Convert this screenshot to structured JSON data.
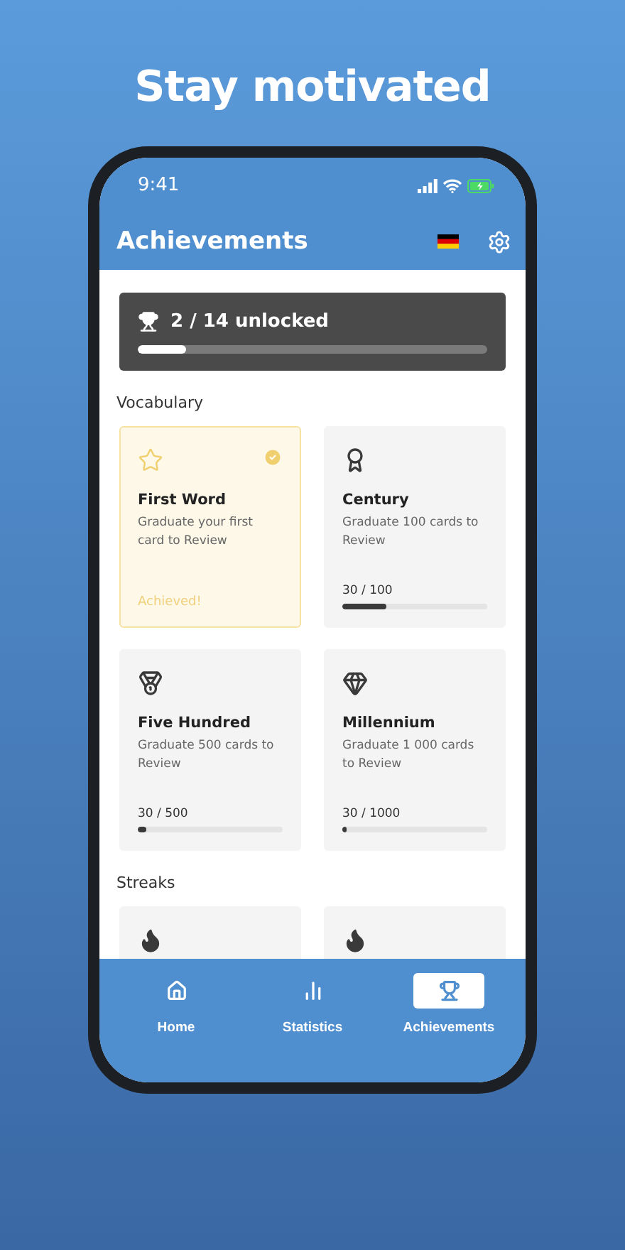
{
  "headline": "Stay motivated",
  "status_bar": {
    "time": "9:41"
  },
  "header": {
    "title": "Achievements"
  },
  "summary": {
    "text": "2 / 14 unlocked",
    "level": 0.14
  },
  "sections": [
    {
      "title": "Vocabulary",
      "cards": [
        {
          "kind": "star",
          "title": "First Word",
          "description": "Graduate your first card to Review",
          "achieved": true,
          "status": "Achieved!"
        },
        {
          "kind": "award",
          "title": "Century",
          "description": "Graduate 100 cards to Review",
          "achieved": false,
          "progress": "30 / 100",
          "level": 0.3
        },
        {
          "kind": "medal",
          "title": "Five Hundred",
          "description": "Graduate 500 cards to Review",
          "achieved": false,
          "progress": "30 / 500",
          "level": 0.06
        },
        {
          "kind": "gem",
          "title": "Millennium",
          "description": "Graduate 1 000 cards to Review",
          "achieved": false,
          "progress": "30 / 1000",
          "level": 0.03
        }
      ]
    },
    {
      "title": "Streaks",
      "cards": [
        {
          "kind": "flame",
          "achieved": false
        },
        {
          "kind": "flame",
          "achieved": false
        }
      ]
    }
  ],
  "nav": [
    {
      "kind": "home",
      "label": "Home",
      "selected": false
    },
    {
      "kind": "chart",
      "label": "Statistics",
      "selected": false
    },
    {
      "kind": "trophy",
      "label": "Achievements",
      "selected": true
    }
  ]
}
